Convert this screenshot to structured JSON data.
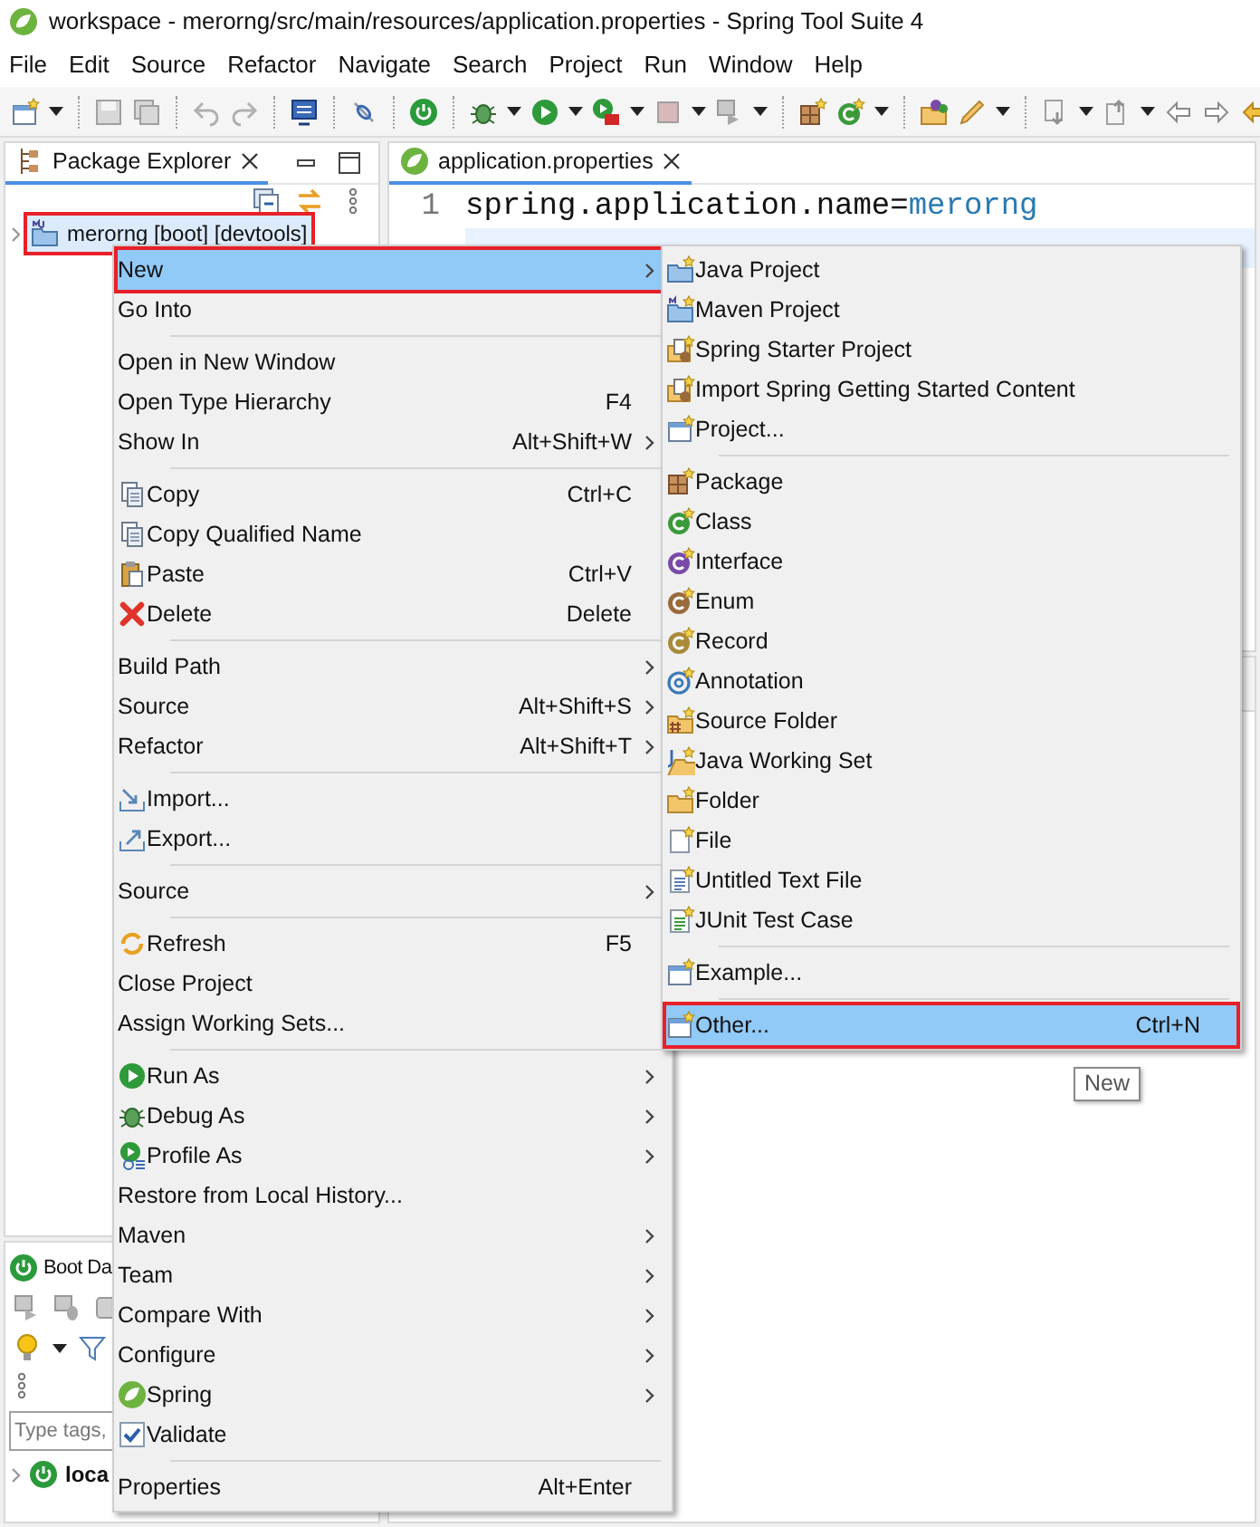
{
  "window": {
    "title": "workspace - merorng/src/main/resources/application.properties - Spring Tool Suite 4"
  },
  "menu_bar": [
    "File",
    "Edit",
    "Source",
    "Refactor",
    "Navigate",
    "Search",
    "Project",
    "Run",
    "Window",
    "Help"
  ],
  "package_explorer": {
    "tab": {
      "label": "Package Explorer",
      "selected": true
    },
    "tree": [
      {
        "label": "merorng [boot] [devtools]",
        "selected": true,
        "highlighted": true
      }
    ]
  },
  "editor": {
    "tab": {
      "label": "application.properties",
      "selected": true
    },
    "lines": [
      {
        "number": "1",
        "key": "spring.application.name=",
        "value": "merorng",
        "current": false
      },
      {
        "current": true
      }
    ]
  },
  "boot_dashboard": {
    "tab": {
      "label": "Boot Da"
    },
    "filter": {
      "placeholder": "Type tags,"
    },
    "tree": [
      {
        "label": "loca"
      }
    ]
  },
  "context_menu": {
    "groups": [
      [
        {
          "label": "New",
          "submenu": true,
          "selected": true,
          "highlighted": true
        },
        {
          "label": "Go Into",
          "submenu": false,
          "selected": false,
          "highlighted": false
        }
      ],
      [
        {
          "label": "Open in New Window",
          "submenu": false,
          "selected": false,
          "highlighted": false
        },
        {
          "label": "Open Type Hierarchy",
          "shortcut": "F4",
          "submenu": false,
          "selected": false,
          "highlighted": false
        },
        {
          "label": "Show In",
          "shortcut": "Alt+Shift+W",
          "submenu": true,
          "selected": false,
          "highlighted": false
        }
      ],
      [
        {
          "label": "Copy",
          "shortcut": "Ctrl+C",
          "submenu": false,
          "selected": false,
          "highlighted": false
        },
        {
          "label": "Copy Qualified Name",
          "submenu": false,
          "selected": false,
          "highlighted": false
        },
        {
          "label": "Paste",
          "shortcut": "Ctrl+V",
          "submenu": false,
          "selected": false,
          "highlighted": false
        },
        {
          "label": "Delete",
          "shortcut": "Delete",
          "submenu": false,
          "selected": false,
          "highlighted": false
        }
      ],
      [
        {
          "label": "Build Path",
          "submenu": true,
          "selected": false,
          "highlighted": false
        },
        {
          "label": "Source",
          "shortcut": "Alt+Shift+S",
          "submenu": true,
          "selected": false,
          "highlighted": false
        },
        {
          "label": "Refactor",
          "shortcut": "Alt+Shift+T",
          "submenu": true,
          "selected": false,
          "highlighted": false
        }
      ],
      [
        {
          "label": "Import...",
          "submenu": false,
          "selected": false,
          "highlighted": false
        },
        {
          "label": "Export...",
          "submenu": false,
          "selected": false,
          "highlighted": false
        }
      ],
      [
        {
          "label": "Source",
          "submenu": true,
          "selected": false,
          "highlighted": false
        }
      ],
      [
        {
          "label": "Refresh",
          "shortcut": "F5",
          "submenu": false,
          "selected": false,
          "highlighted": false
        },
        {
          "label": "Close Project",
          "submenu": false,
          "selected": false,
          "highlighted": false
        },
        {
          "label": "Assign Working Sets...",
          "submenu": false,
          "selected": false,
          "highlighted": false
        }
      ],
      [
        {
          "label": "Run As",
          "submenu": true,
          "selected": false,
          "highlighted": false
        },
        {
          "label": "Debug As",
          "submenu": true,
          "selected": false,
          "highlighted": false
        },
        {
          "label": "Profile As",
          "submenu": true,
          "selected": false,
          "highlighted": false
        },
        {
          "label": "Restore from Local History...",
          "submenu": false,
          "selected": false,
          "highlighted": false
        },
        {
          "label": "Maven",
          "submenu": true,
          "selected": false,
          "highlighted": false
        },
        {
          "label": "Team",
          "submenu": true,
          "selected": false,
          "highlighted": false
        },
        {
          "label": "Compare With",
          "submenu": true,
          "selected": false,
          "highlighted": false
        },
        {
          "label": "Configure",
          "submenu": true,
          "selected": false,
          "highlighted": false
        },
        {
          "label": "Spring",
          "submenu": true,
          "selected": false,
          "highlighted": false
        },
        {
          "label": "Validate",
          "submenu": false,
          "selected": false,
          "highlighted": false
        }
      ],
      [
        {
          "label": "Properties",
          "shortcut": "Alt+Enter",
          "submenu": false,
          "selected": false,
          "highlighted": false
        }
      ]
    ]
  },
  "new_submenu": {
    "groups": [
      [
        {
          "label": "Java Project",
          "selected": false,
          "highlighted": false
        },
        {
          "label": "Maven Project",
          "selected": false,
          "highlighted": false
        },
        {
          "label": "Spring Starter Project",
          "selected": false,
          "highlighted": false
        },
        {
          "label": "Import Spring Getting Started Content",
          "selected": false,
          "highlighted": false
        },
        {
          "label": "Project...",
          "selected": false,
          "highlighted": false
        }
      ],
      [
        {
          "label": "Package",
          "selected": false,
          "highlighted": false
        },
        {
          "label": "Class",
          "selected": false,
          "highlighted": false
        },
        {
          "label": "Interface",
          "selected": false,
          "highlighted": false
        },
        {
          "label": "Enum",
          "selected": false,
          "highlighted": false
        },
        {
          "label": "Record",
          "selected": false,
          "highlighted": false
        },
        {
          "label": "Annotation",
          "selected": false,
          "highlighted": false
        },
        {
          "label": "Source Folder",
          "selected": false,
          "highlighted": false
        },
        {
          "label": "Java Working Set",
          "selected": false,
          "highlighted": false
        },
        {
          "label": "Folder",
          "selected": false,
          "highlighted": false
        },
        {
          "label": "File",
          "selected": false,
          "highlighted": false
        },
        {
          "label": "Untitled Text File",
          "selected": false,
          "highlighted": false
        },
        {
          "label": "JUnit Test Case",
          "selected": false,
          "highlighted": false
        }
      ],
      [
        {
          "label": "Example...",
          "selected": false,
          "highlighted": false
        }
      ],
      [
        {
          "label": "Other...",
          "shortcut": "Ctrl+N",
          "selected": true,
          "highlighted": true
        }
      ]
    ]
  },
  "tooltip": {
    "text": "New"
  }
}
